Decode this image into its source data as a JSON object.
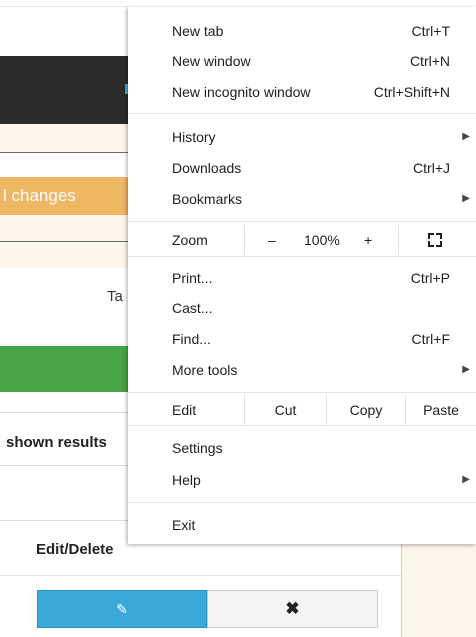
{
  "background": {
    "orange_text": "l changes",
    "tab_label": "Ta",
    "shown_results": "shown results",
    "edit_delete": "Edit/Delete",
    "edit_button_icon": "edit-icon",
    "delete_button_icon": "close-icon",
    "edit_glyph": "✎",
    "delete_glyph": "✖"
  },
  "menu": {
    "items_top": [
      {
        "label": "New tab",
        "shortcut": "Ctrl+T"
      },
      {
        "label": "New window",
        "shortcut": "Ctrl+N"
      },
      {
        "label": "New incognito window",
        "shortcut": "Ctrl+Shift+N"
      }
    ],
    "items_mid": [
      {
        "label": "History",
        "shortcut": ""
      },
      {
        "label": "Downloads",
        "shortcut": "Ctrl+J"
      },
      {
        "label": "Bookmarks",
        "shortcut": ""
      }
    ],
    "zoom": {
      "label": "Zoom",
      "minus": "–",
      "value": "100%",
      "plus": "+"
    },
    "items_tools": [
      {
        "label": "Print...",
        "shortcut": "Ctrl+P"
      },
      {
        "label": "Cast...",
        "shortcut": ""
      },
      {
        "label": "Find...",
        "shortcut": "Ctrl+F"
      },
      {
        "label": "More tools",
        "shortcut": ""
      }
    ],
    "edit": {
      "label": "Edit",
      "cut": "Cut",
      "copy": "Copy",
      "paste": "Paste"
    },
    "items_settings": [
      {
        "label": "Settings"
      },
      {
        "label": "Help"
      }
    ],
    "exit": "Exit",
    "submenu_arrow": "▶"
  }
}
